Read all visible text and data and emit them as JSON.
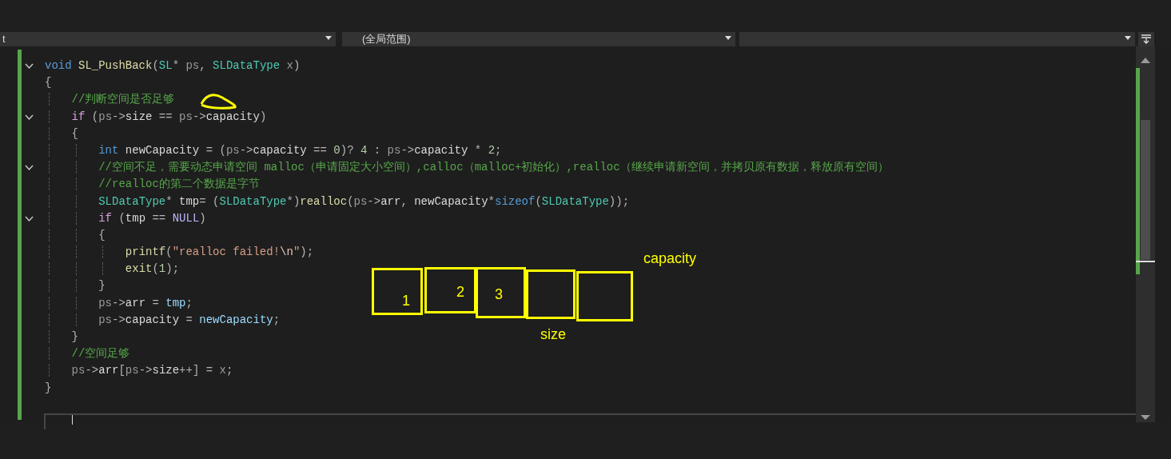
{
  "navigation_bar": {
    "dropdowns": [
      {
        "text": "t"
      },
      {
        "text": "(全局范围)"
      }
    ]
  },
  "editor": {
    "lines": [
      {
        "expanded": true,
        "tokens": [
          {
            "kind": "kw",
            "text": "void"
          },
          {
            "kind": "fn",
            "text": " SL_PushBack"
          },
          {
            "kind": "op",
            "text": "("
          },
          {
            "kind": "ty",
            "text": "SL"
          },
          {
            "kind": "op",
            "text": "* "
          },
          {
            "kind": "pa",
            "text": "ps"
          },
          {
            "kind": "op",
            "text": ", "
          },
          {
            "kind": "ty",
            "text": "SLDataType"
          },
          {
            "kind": "pa",
            "text": " x"
          },
          {
            "kind": "op",
            "text": ")"
          }
        ]
      },
      {
        "tokens": [
          {
            "kind": "op",
            "text": "{"
          }
        ]
      },
      {
        "tokens": [
          {
            "kind": "cm",
            "text": "    //判断空间是否足够"
          }
        ]
      },
      {
        "expanded": true,
        "tokens": [
          {
            "kind": "ctl",
            "text": "    if"
          },
          {
            "kind": "op",
            "text": " ("
          },
          {
            "kind": "pa",
            "text": "ps"
          },
          {
            "kind": "op",
            "text": "->"
          },
          {
            "kind": "mem",
            "text": "size"
          },
          {
            "kind": "op",
            "text": " == "
          },
          {
            "kind": "pa",
            "text": "ps"
          },
          {
            "kind": "op",
            "text": "->"
          },
          {
            "kind": "mem",
            "text": "capacity"
          },
          {
            "kind": "op",
            "text": ")"
          }
        ]
      },
      {
        "tokens": [
          {
            "kind": "op",
            "text": "    {"
          }
        ]
      },
      {
        "tokens": [
          {
            "kind": "kw",
            "text": "        int"
          },
          {
            "kind": "mem",
            "text": " newCapacity"
          },
          {
            "kind": "op",
            "text": " = ("
          },
          {
            "kind": "pa",
            "text": "ps"
          },
          {
            "kind": "op",
            "text": "->"
          },
          {
            "kind": "mem",
            "text": "capacity"
          },
          {
            "kind": "op",
            "text": " == "
          },
          {
            "kind": "num",
            "text": "0"
          },
          {
            "kind": "op",
            "text": ")? "
          },
          {
            "kind": "num",
            "text": "4"
          },
          {
            "kind": "op",
            "text": " : "
          },
          {
            "kind": "pa",
            "text": "ps"
          },
          {
            "kind": "op",
            "text": "->"
          },
          {
            "kind": "mem",
            "text": "capacity"
          },
          {
            "kind": "op",
            "text": " * "
          },
          {
            "kind": "num",
            "text": "2"
          },
          {
            "kind": "op",
            "text": ";"
          }
        ]
      },
      {
        "expanded": true,
        "tokens": [
          {
            "kind": "cm",
            "text": "        //空间不足，需要动态申请空间 malloc（申请固定大小空间）,calloc（malloc+初始化）,realloc（继续申请新空间，并拷贝原有数据，释放原有空间）"
          }
        ]
      },
      {
        "tokens": [
          {
            "kind": "cm",
            "text": "        //realloc的第二个数据是字节"
          }
        ]
      },
      {
        "tokens": [
          {
            "kind": "ty",
            "text": "        SLDataType"
          },
          {
            "kind": "op",
            "text": "* "
          },
          {
            "kind": "mem",
            "text": "tmp"
          },
          {
            "kind": "op",
            "text": "= ("
          },
          {
            "kind": "ty",
            "text": "SLDataType"
          },
          {
            "kind": "op",
            "text": "*)"
          },
          {
            "kind": "fn",
            "text": "realloc"
          },
          {
            "kind": "op",
            "text": "("
          },
          {
            "kind": "pa",
            "text": "ps"
          },
          {
            "kind": "op",
            "text": "->"
          },
          {
            "kind": "mem",
            "text": "arr"
          },
          {
            "kind": "op",
            "text": ", "
          },
          {
            "kind": "mem",
            "text": "newCapacity"
          },
          {
            "kind": "op",
            "text": "*"
          },
          {
            "kind": "kw",
            "text": "sizeof"
          },
          {
            "kind": "op",
            "text": "("
          },
          {
            "kind": "ty",
            "text": "SLDataType"
          },
          {
            "kind": "op",
            "text": "));"
          }
        ]
      },
      {
        "expanded": true,
        "tokens": [
          {
            "kind": "ctl",
            "text": "        if"
          },
          {
            "kind": "op",
            "text": " ("
          },
          {
            "kind": "mem",
            "text": "tmp"
          },
          {
            "kind": "op",
            "text": " == "
          },
          {
            "kind": "mac",
            "text": "NULL"
          },
          {
            "kind": "op",
            "text": ")"
          }
        ]
      },
      {
        "tokens": [
          {
            "kind": "op",
            "text": "        {"
          }
        ]
      },
      {
        "tokens": [
          {
            "kind": "fn",
            "text": "            printf"
          },
          {
            "kind": "op",
            "text": "("
          },
          {
            "kind": "str",
            "text": "\"realloc failed!"
          },
          {
            "kind": "esc",
            "text": "\\n"
          },
          {
            "kind": "str",
            "text": "\""
          },
          {
            "kind": "op",
            "text": ");"
          }
        ]
      },
      {
        "tokens": [
          {
            "kind": "fn",
            "text": "            exit"
          },
          {
            "kind": "op",
            "text": "("
          },
          {
            "kind": "num",
            "text": "1"
          },
          {
            "kind": "op",
            "text": ");"
          }
        ]
      },
      {
        "tokens": [
          {
            "kind": "op",
            "text": "        }"
          }
        ]
      },
      {
        "tokens": [
          {
            "kind": "pa",
            "text": "        ps"
          },
          {
            "kind": "op",
            "text": "->"
          },
          {
            "kind": "mem",
            "text": "arr"
          },
          {
            "kind": "op",
            "text": " = "
          },
          {
            "kind": "loc",
            "text": "tmp"
          },
          {
            "kind": "op",
            "text": ";"
          }
        ]
      },
      {
        "tokens": [
          {
            "kind": "pa",
            "text": "        ps"
          },
          {
            "kind": "op",
            "text": "->"
          },
          {
            "kind": "mem",
            "text": "capacity"
          },
          {
            "kind": "op",
            "text": " = "
          },
          {
            "kind": "loc",
            "text": "newCapacity"
          },
          {
            "kind": "op",
            "text": ";"
          }
        ]
      },
      {
        "tokens": [
          {
            "kind": "op",
            "text": "    }"
          }
        ]
      },
      {
        "tokens": [
          {
            "kind": "cm",
            "text": "    //空间足够"
          }
        ]
      },
      {
        "tokens": [
          {
            "kind": "pa",
            "text": "    ps"
          },
          {
            "kind": "op",
            "text": "->"
          },
          {
            "kind": "mem",
            "text": "arr"
          },
          {
            "kind": "op",
            "text": "["
          },
          {
            "kind": "pa",
            "text": "ps"
          },
          {
            "kind": "op",
            "text": "->"
          },
          {
            "kind": "mem",
            "text": "size"
          },
          {
            "kind": "op",
            "text": "++] = "
          },
          {
            "kind": "pa",
            "text": "x"
          },
          {
            "kind": "op",
            "text": ";"
          }
        ]
      },
      {
        "tokens": [
          {
            "kind": "op",
            "text": "}"
          }
        ]
      }
    ]
  },
  "annotations": [
    {
      "kind": "box",
      "label": "1"
    },
    {
      "kind": "box",
      "label": "2"
    },
    {
      "kind": "box",
      "label": "3"
    },
    {
      "kind": "box"
    },
    {
      "kind": "box"
    },
    {
      "kind": "text",
      "text": "capacity"
    },
    {
      "kind": "text",
      "text": "size"
    }
  ]
}
